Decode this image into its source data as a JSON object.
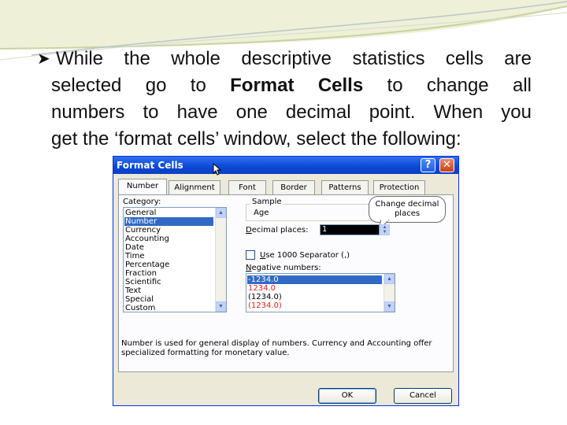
{
  "slide": {
    "lines": [
      "While the whole descriptive statistics cells are",
      "selected go to ",
      "Format Cells",
      " to change all",
      "numbers to have one decimal point. When you",
      "get the ‘format cells’ window, select the following:"
    ]
  },
  "dialog": {
    "title": "Format Cells",
    "help_label": "?",
    "close_label": "✕",
    "tabs": [
      "Number",
      "Alignment",
      "Font",
      "Border",
      "Patterns",
      "Protection"
    ],
    "category_label": "Category:",
    "categories": [
      "General",
      "Number",
      "Currency",
      "Accounting",
      "Date",
      "Time",
      "Percentage",
      "Fraction",
      "Scientific",
      "Text",
      "Special",
      "Custom"
    ],
    "selected_category": "Number",
    "sample_label": "Sample",
    "sample_value": "Age",
    "decimal_label": "Decimal places:",
    "decimal_value": "1",
    "separator_label": "Use 1000 Separator (,)",
    "negative_label": "Negative numbers:",
    "negative_options": [
      "-1234.0",
      "1234.0",
      "(1234.0)",
      "(1234.0)"
    ],
    "callout": "Change decimal places",
    "description": "Number is used for general display of numbers.  Currency and Accounting offer specialized formatting for monetary value.",
    "ok_label": "OK",
    "cancel_label": "Cancel"
  },
  "colors": {
    "titlebar": "#0a48d6",
    "selection": "#316ac5",
    "negative_red": "#e02020"
  }
}
